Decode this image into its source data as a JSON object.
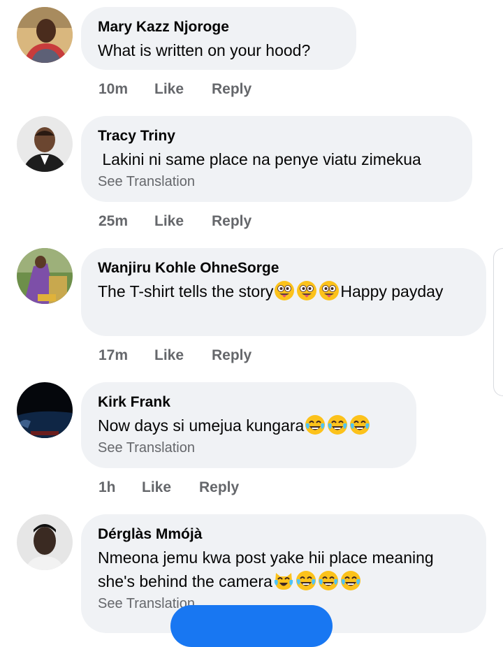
{
  "comments": [
    {
      "author": "Mary Kazz Njoroge",
      "text": "What is written on your hood?",
      "time": "10m",
      "like": "Like",
      "reply": "Reply",
      "avatar_icon": "woman-portrait-avatar"
    },
    {
      "author": "Tracy Triny",
      "text": " Lakini ni same place na penye viatu zimekua",
      "translation": "See Translation",
      "time": "25m",
      "like": "Like",
      "reply": "Reply",
      "avatar_icon": "man-portrait-avatar"
    },
    {
      "author": "Wanjiru Kohle OhneSorge",
      "text_before": "The T-shirt tells the story",
      "emojis": [
        "zany-face-icon",
        "zany-face-icon",
        "zany-face-icon"
      ],
      "text_after": "Happy payday",
      "time": "17m",
      "like": "Like",
      "reply": "Reply",
      "avatar_icon": "colorful-photo-avatar"
    },
    {
      "author": "Kirk Frank",
      "text": "Now days si umejua kungara",
      "emojis": [
        "tears-of-joy-icon",
        "tears-of-joy-icon",
        "tears-of-joy-icon"
      ],
      "translation": "See Translation",
      "time": "1h",
      "like": "Like",
      "reply": "Reply",
      "avatar_icon": "dark-photo-avatar"
    },
    {
      "author": "Dérglàs Mmójà",
      "text_line1": "Nmeona jemu kwa post yake hii place meaning",
      "text_line2": "she's behind the camera",
      "emojis": [
        "crying-laughing-cat-icon",
        "tears-of-joy-icon",
        "tears-of-joy-icon",
        "tears-of-joy-icon"
      ],
      "translation": "See Translation",
      "avatar_icon": "young-man-avatar"
    }
  ],
  "colors": {
    "bubble": "#f0f2f5",
    "meta_text": "#65676b",
    "primary_button": "#1877f2"
  }
}
